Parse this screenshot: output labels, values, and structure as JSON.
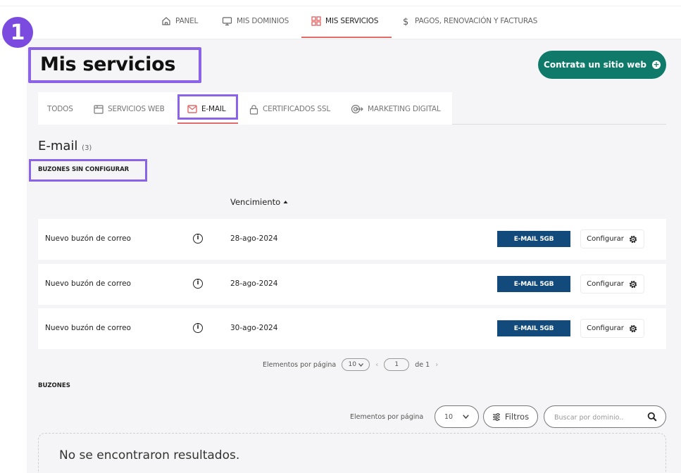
{
  "top_nav": {
    "items": [
      {
        "label": "PANEL",
        "icon": "home-icon"
      },
      {
        "label": "MIS DOMINIOS",
        "icon": "monitor-icon"
      },
      {
        "label": "MIS SERVICIOS",
        "icon": "grid-icon",
        "active": true
      },
      {
        "label": "PAGOS, RENOVACIÓN Y FACTURAS",
        "icon": "dollar-icon"
      }
    ]
  },
  "step_badge": "1",
  "page_title": "Mis servicios",
  "cta_label": "Contrata un sitio web",
  "tabs": [
    {
      "label": "TODOS"
    },
    {
      "label": "SERVICIOS WEB",
      "icon": "browser-icon"
    },
    {
      "label": "E-MAIL",
      "icon": "mail-icon",
      "active": true
    },
    {
      "label": "CERTIFICADOS SSL",
      "icon": "lock-icon"
    },
    {
      "label": "MARKETING DIGITAL",
      "icon": "target-icon"
    }
  ],
  "section": {
    "title": "E-mail",
    "count": "(3)",
    "unconfigured_label": "BUZONES SIN CONFIGURAR",
    "column_header": "Vencimiento"
  },
  "rows": [
    {
      "name": "Nuevo buzón de correo",
      "date": "28-ago-2024",
      "plan": "E-MAIL 5GB",
      "action": "Configurar"
    },
    {
      "name": "Nuevo buzón de correo",
      "date": "28-ago-2024",
      "plan": "E-MAIL 5GB",
      "action": "Configurar"
    },
    {
      "name": "Nuevo buzón de correo",
      "date": "30-ago-2024",
      "plan": "E-MAIL 5GB",
      "action": "Configurar"
    }
  ],
  "pagination": {
    "per_page_label": "Elementos por página",
    "per_page_value": "10",
    "page": "1",
    "of_label": "de 1"
  },
  "buzones": {
    "title": "BUZONES",
    "per_page_label": "Elementos por página",
    "per_page_value": "10",
    "filters_label": "Filtros",
    "search_placeholder": "Buscar por dominio..",
    "empty_message": "No se encontraron resultados."
  },
  "colors": {
    "accent_red": "#e26a6a",
    "cta_green": "#0f7a6a",
    "plan_blue": "#124a7c",
    "highlight_purple": "#8b63e6"
  }
}
